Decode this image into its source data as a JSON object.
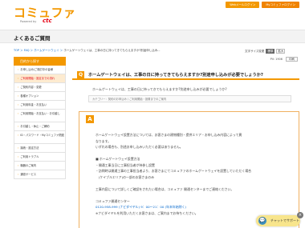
{
  "header": {
    "logo_text": "コミュファ",
    "logo_sub": "Powered by",
    "logo_brand": "ctc",
    "links": [
      "Webメールログイン",
      "Myコミュファログイン"
    ]
  },
  "page_title": "よくあるご質問",
  "breadcrumb": {
    "items": [
      "TOP",
      "FAQ",
      "ホームゲートウェイ"
    ],
    "current": "ホームゲートウェイは、工事の日に持ってきてもらえますか?別途申し込み..."
  },
  "font_size": {
    "label": "文字サイズ変更",
    "options": [
      "標準",
      "拡大"
    ],
    "selected": "標準"
  },
  "sidebar": {
    "title": "目的から探す",
    "items": [
      "お申し込み/ご検討中の皆様",
      "ご利用開始・設定までの流れ",
      "ご契約内容・変更",
      "各種オプション",
      "ご利用料金・お支払い",
      "ご利用開始・お支払い・お引越し",
      "お引越し・休止・ご解約",
      "ID・パスワード・Myコミュファ関連",
      "接続・設定方法",
      "ご利用トラブル",
      "機器のご案内",
      "通信サービス"
    ],
    "active_index": 1
  },
  "question": {
    "views_label": "PV: 1906",
    "print_label": "印刷",
    "badge": "Q",
    "title": "ホームゲートウェイは、工事の日に持ってきてもらえますか?別途申し込みが必要でしょうか?",
    "body": "ホームゲートウェイは、工事の日に持ってきてもらえますか?別途申し込みが必要でしょうか?",
    "category": "カテゴリー：契約のお申込み / ご利用開始・設置までのご案内"
  },
  "answer": {
    "badge": "A",
    "lines": [
      "ホームゲートウェイ設置方法については、お客さまの建物種別・提供エリア・お申し込み内容によって異",
      "なります。",
      "いずれの場合も、別途お申し込みいただく必要はありません。",
      "",
      "■ ホームゲートウェイ設置方法",
      "・開通工事当日に工事担当者が持参し設置",
      "・訪問時は開通工事の工事担当者より、お客さまにてコミュファのホームゲートウェイを設置していただく場合",
      "　(ケイブルエリア)の一部のお客さまのみ",
      "",
      "工事内容について詳しくご確認をされたい場合は、コミュファ 開通センターまでご連絡ください。",
      "",
      "コミュファ開通センター",
      "0120-958-999 (ナビダイヤル) 9：00〜21：00 (年末年始除く)",
      "※ナビダイヤルを利用いただくお客さまは、ご案内までお待ちください。"
    ],
    "link_line_index": 12
  },
  "chat": {
    "label": "チャットでサポート",
    "icon": "chat-icon",
    "close": "×"
  }
}
